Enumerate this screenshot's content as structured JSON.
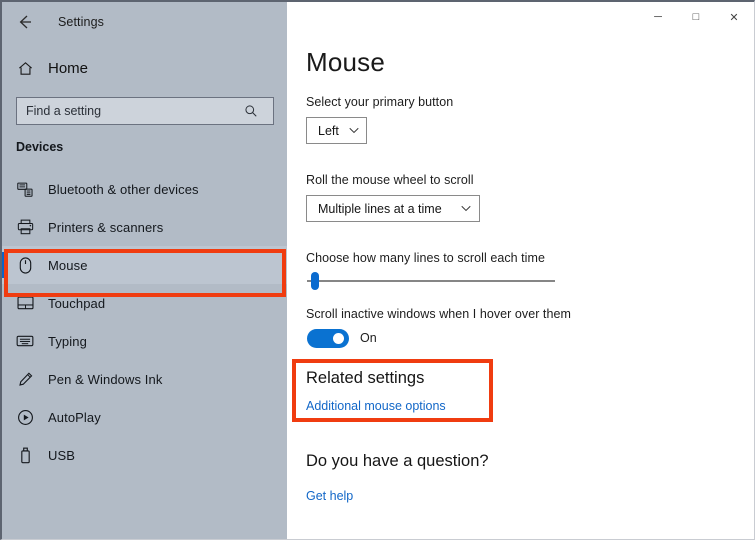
{
  "window": {
    "title": "Settings",
    "back_icon": "back-arrow-icon",
    "controls": [
      {
        "name": "minimize-button",
        "glyph": "─"
      },
      {
        "name": "maximize-button",
        "glyph": "□"
      },
      {
        "name": "close-button",
        "glyph": "✕"
      }
    ]
  },
  "sidebar": {
    "home_label": "Home",
    "home_icon": "home-icon",
    "search": {
      "placeholder": "Find a setting",
      "value": "",
      "icon": "search-icon"
    },
    "section_label": "Devices",
    "items": [
      {
        "label": "Bluetooth & other devices",
        "icon": "bluetooth-device-icon",
        "selected": false
      },
      {
        "label": "Printers & scanners",
        "icon": "printer-icon",
        "selected": false
      },
      {
        "label": "Mouse",
        "icon": "mouse-icon",
        "selected": true
      },
      {
        "label": "Touchpad",
        "icon": "touchpad-icon",
        "selected": false
      },
      {
        "label": "Typing",
        "icon": "keyboard-icon",
        "selected": false
      },
      {
        "label": "Pen & Windows Ink",
        "icon": "pen-icon",
        "selected": false
      },
      {
        "label": "AutoPlay",
        "icon": "autoplay-icon",
        "selected": false
      },
      {
        "label": "USB",
        "icon": "usb-icon",
        "selected": false
      }
    ]
  },
  "main": {
    "page_title": "Mouse",
    "primary_button": {
      "label": "Select your primary button",
      "value": "Left",
      "chevron_icon": "chevron-down-icon"
    },
    "wheel_scroll": {
      "label": "Roll the mouse wheel to scroll",
      "value": "Multiple lines at a time",
      "chevron_icon": "chevron-down-icon"
    },
    "lines_slider": {
      "label": "Choose how many lines to scroll each time",
      "position_percent": 3
    },
    "inactive_scroll": {
      "label": "Scroll inactive windows when I hover over them",
      "state": "On",
      "checked": true
    },
    "related_settings": {
      "heading": "Related settings",
      "link": "Additional mouse options"
    },
    "question": {
      "heading": "Do you have a question?",
      "link": "Get help"
    }
  },
  "annotations": {
    "color": "#f03c10",
    "boxes": [
      {
        "name": "highlight-mouse-nav",
        "target": "Mouse"
      },
      {
        "name": "highlight-related-settings",
        "target": "Related settings"
      }
    ]
  }
}
